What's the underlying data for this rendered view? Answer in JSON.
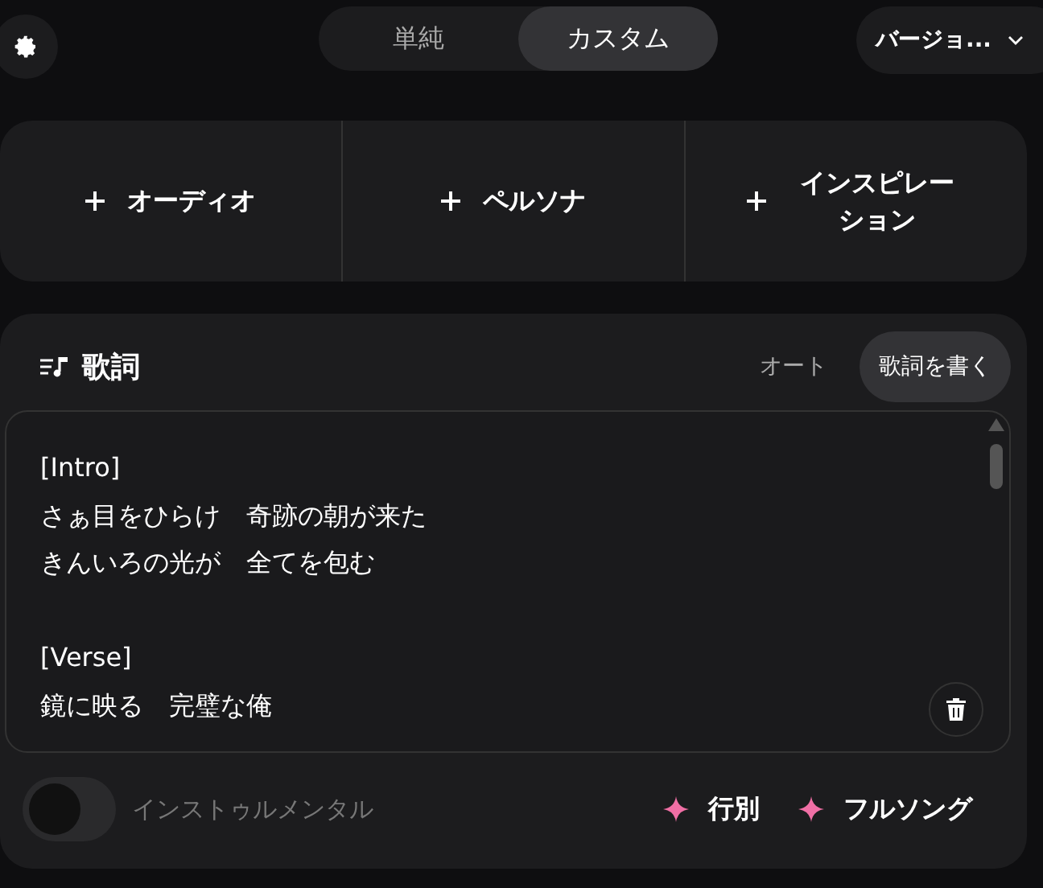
{
  "mode_tabs": [
    {
      "label": "単純",
      "selected": false
    },
    {
      "label": "カスタム",
      "selected": true
    }
  ],
  "version_dropdown": {
    "value": "バージョ..."
  },
  "add_cards": [
    {
      "label": "オーディオ"
    },
    {
      "label": "ペルソナ"
    },
    {
      "label": "インスピレーション"
    }
  ],
  "lyrics": {
    "title": "歌詞",
    "auto_label": "オート",
    "write_button": "歌詞を書く",
    "stanzas": [
      [
        "[Intro]",
        "さぁ目をひらけ　奇跡の朝が来た",
        "きんいろの光が　全てを包む"
      ],
      [
        "[Verse]",
        "鏡に映る　完璧な俺"
      ]
    ]
  },
  "instrumental": {
    "label": "インストゥルメンタル",
    "on": false
  },
  "generate_buttons": [
    {
      "label": "行別"
    },
    {
      "label": "フルソング"
    }
  ]
}
